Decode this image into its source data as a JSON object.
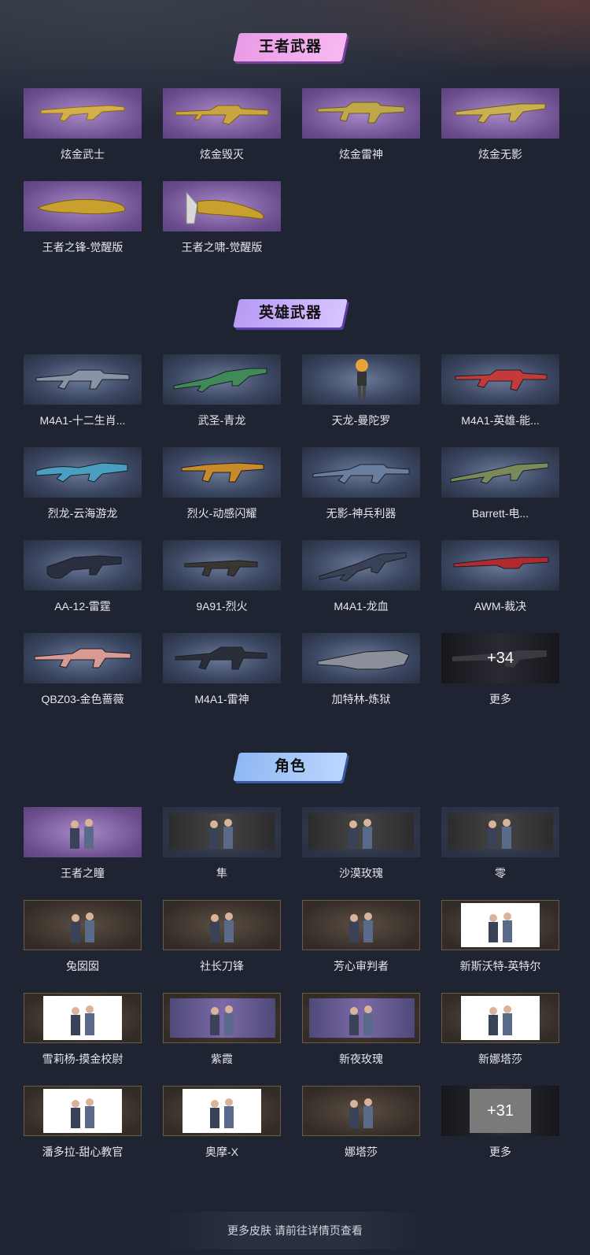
{
  "sections": {
    "king_weapons": {
      "title": "王者武器",
      "items": [
        {
          "name": "炫金武士"
        },
        {
          "name": "炫金毁灭"
        },
        {
          "name": "炫金雷神"
        },
        {
          "name": "炫金无影"
        },
        {
          "name": "王者之锋-觉醒版"
        },
        {
          "name": "王者之啸-觉醒版"
        }
      ]
    },
    "hero_weapons": {
      "title": "英雄武器",
      "items": [
        {
          "name": "M4A1-十二生肖..."
        },
        {
          "name": "武圣-青龙"
        },
        {
          "name": "天龙-曼陀罗"
        },
        {
          "name": "M4A1-英雄-能..."
        },
        {
          "name": "烈龙-云海游龙"
        },
        {
          "name": "烈火-动感闪耀"
        },
        {
          "name": "无影-神兵利器"
        },
        {
          "name": "Barrett-电..."
        },
        {
          "name": "AA-12-雷霆"
        },
        {
          "name": "9A91-烈火"
        },
        {
          "name": "M4A1-龙血"
        },
        {
          "name": "AWM-裁决"
        },
        {
          "name": "QBZ03-金色蔷薇"
        },
        {
          "name": "M4A1-雷神"
        },
        {
          "name": "加特林-炼狱"
        }
      ],
      "more_count": "+34",
      "more_label": "更多"
    },
    "characters": {
      "title": "角色",
      "items": [
        {
          "name": "王者之瞳"
        },
        {
          "name": "隼"
        },
        {
          "name": "沙漠玫瑰"
        },
        {
          "name": "零"
        },
        {
          "name": "兔囡囡"
        },
        {
          "name": "社长刀锋"
        },
        {
          "name": "芳心审判者"
        },
        {
          "name": "新斯沃特-英特尔"
        },
        {
          "name": "雪莉杨-摸金校尉"
        },
        {
          "name": "紫霞"
        },
        {
          "name": "新夜玫瑰"
        },
        {
          "name": "新娜塔莎"
        },
        {
          "name": "潘多拉-甜心教官"
        },
        {
          "name": "奥摩-X"
        },
        {
          "name": "娜塔莎"
        }
      ],
      "more_count": "+31",
      "more_label": "更多"
    }
  },
  "footer": {
    "text": "更多皮肤 请前往详情页查看"
  },
  "colors": {
    "background": "#1f2433",
    "king_banner": "#f2a9ee",
    "hero_banner": "#c9b2fb",
    "character_banner": "#a8c8fb"
  }
}
